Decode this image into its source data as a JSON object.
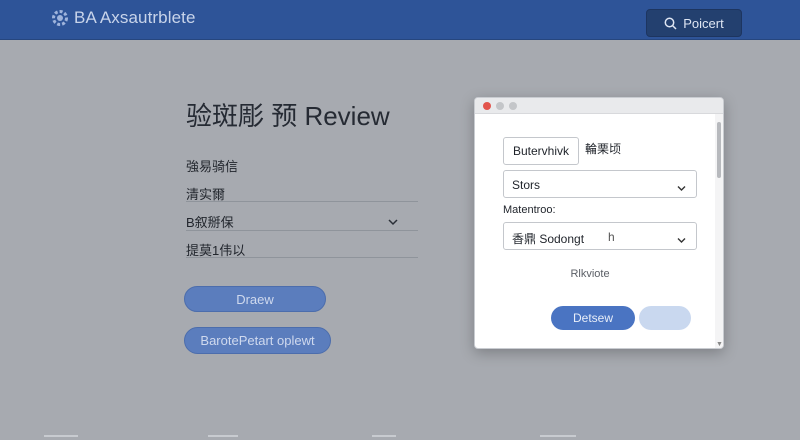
{
  "header": {
    "app_title": "BA Axsautrblete",
    "app_icon": "gear-icon",
    "search_button_label": "Poicert",
    "search_icon": "search-icon",
    "colors": {
      "bar": "#2e5498",
      "button": "#23406f"
    }
  },
  "background_form": {
    "title": "验斑彫 预 Review",
    "fields": [
      "強易骑信",
      "清实爾",
      "B叙掰保",
      "提莫1伟以"
    ],
    "buttons": {
      "primary": "Draew",
      "secondary": "BarotePetart oplewt"
    },
    "button_color": "#5b7dbd"
  },
  "dialog": {
    "chip_button": "Butervhivk",
    "chip_label": "輪栗顷",
    "select_1_value": "Stors",
    "field_label": "Matentroo:",
    "select_2_value": "香鼎 Sodongt",
    "select_2_suffix": "h",
    "link": "Rlkviote",
    "primary_button": "Detsew",
    "colors": {
      "primary": "#4a74c2",
      "secondary": "#c9d8ef",
      "close": "#e2544c"
    }
  }
}
